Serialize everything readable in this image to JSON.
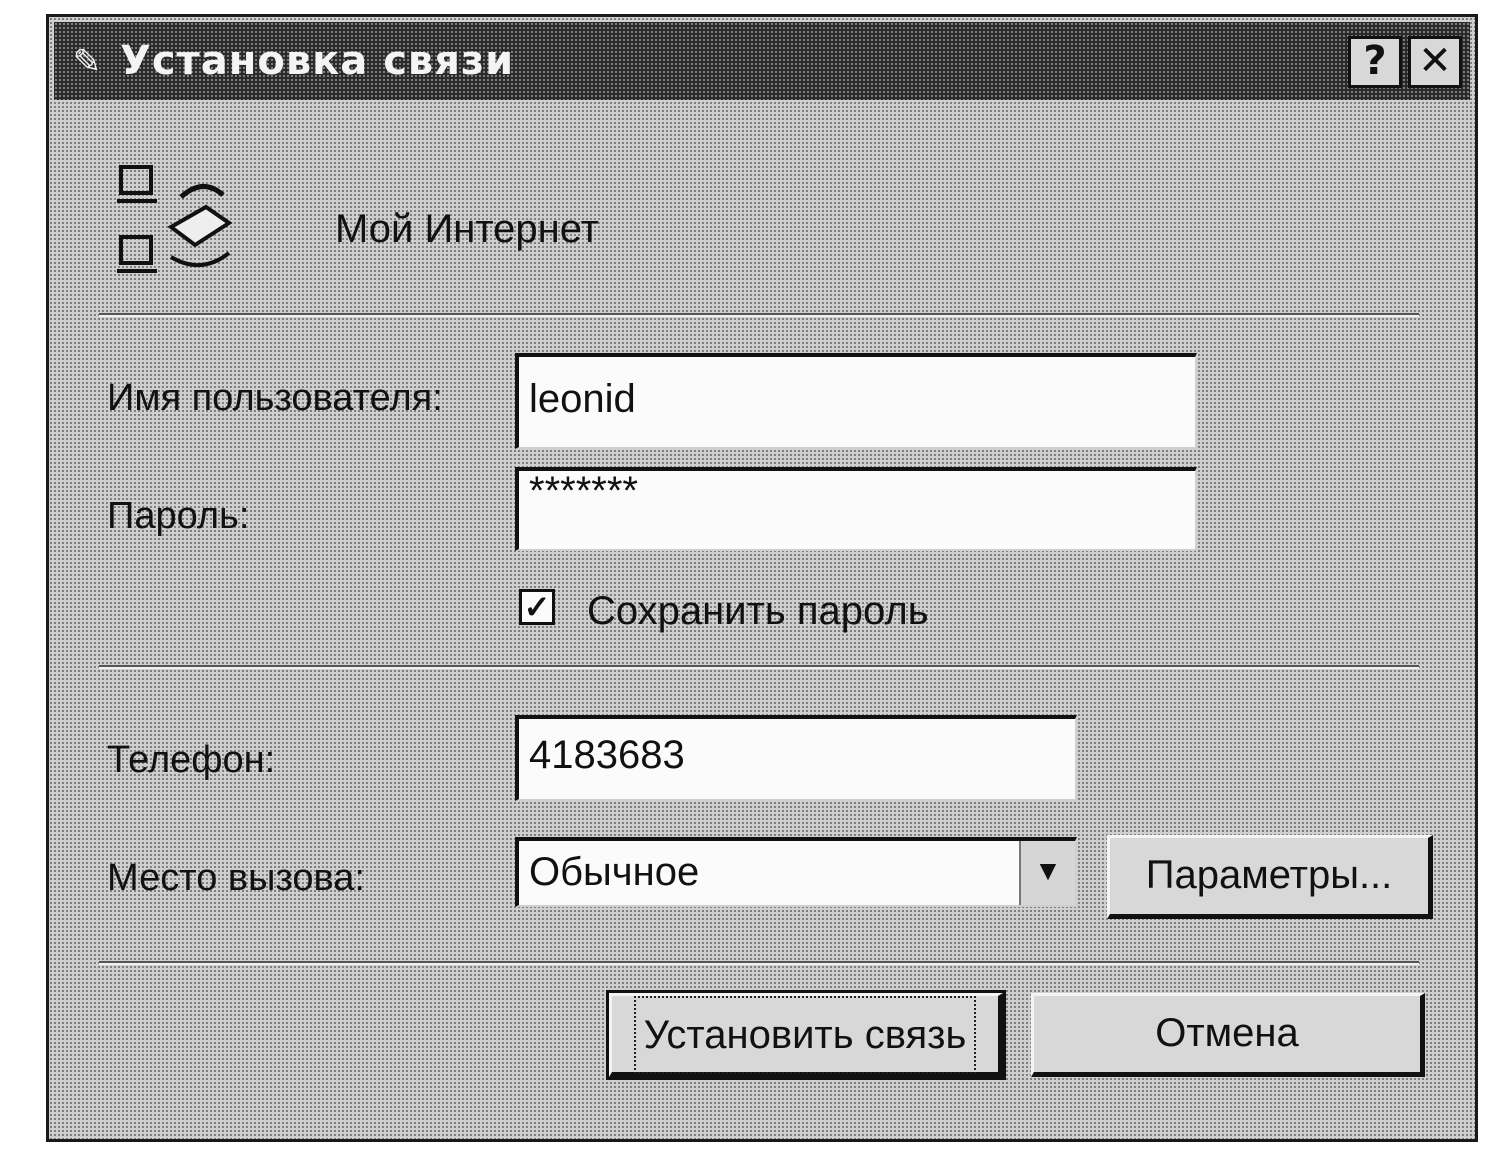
{
  "window": {
    "title": "Установка связи",
    "help_glyph": "?",
    "close_glyph": "✕"
  },
  "connection": {
    "name": "Мой Интернет",
    "icon": "dial-up-connection-icon"
  },
  "form": {
    "username_label": "Имя пользователя:",
    "username_value": "leonid",
    "password_label": "Пароль:",
    "password_value": "*******",
    "save_password_label": "Сохранить пароль",
    "save_password_checked": true,
    "save_password_glyph": "✓",
    "phone_label": "Телефон:",
    "phone_value": "4183683",
    "dial_from_label": "Место вызова:",
    "dial_from_value": "Обычное",
    "dropdown_arrow_glyph": "▼"
  },
  "buttons": {
    "settings_label": "Параметры...",
    "connect_label": "Установить связь",
    "cancel_label": "Отмена"
  }
}
